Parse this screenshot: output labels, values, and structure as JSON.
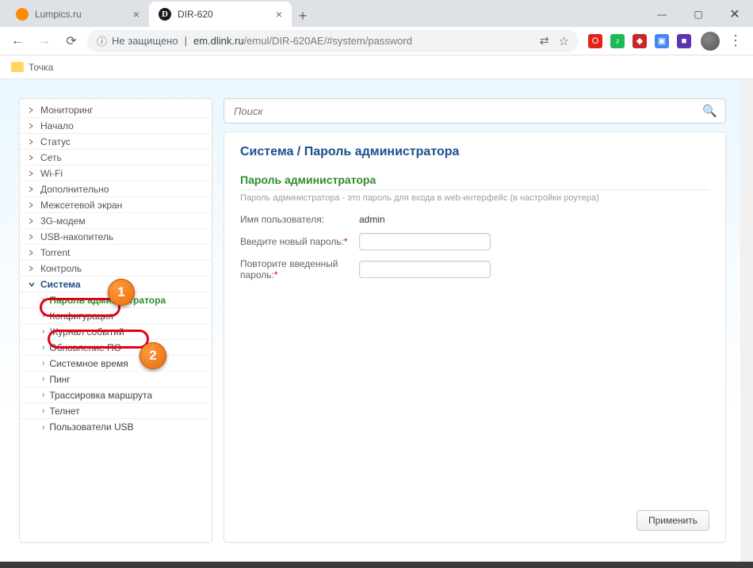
{
  "browser": {
    "tabs": [
      {
        "favicon": "orange",
        "title": "Lumpics.ru",
        "active": false
      },
      {
        "favicon": "dark",
        "title": "DIR-620",
        "active": true
      }
    ],
    "nav": {
      "not_secure": "Не защищено",
      "url_host": "em.dlink.ru",
      "url_path": "/emul/DIR-620AE/#system/password"
    },
    "bookmark": "Точка"
  },
  "sidebar": {
    "items": [
      {
        "label": "Мониторинг"
      },
      {
        "label": "Начало"
      },
      {
        "label": "Статус"
      },
      {
        "label": "Сеть"
      },
      {
        "label": "Wi-Fi"
      },
      {
        "label": "Дополнительно"
      },
      {
        "label": "Межсетевой экран"
      },
      {
        "label": "3G-модем"
      },
      {
        "label": "USB-накопитель"
      },
      {
        "label": "Torrent"
      },
      {
        "label": "Контроль"
      }
    ],
    "expanded": {
      "label": "Система"
    },
    "subitems": [
      {
        "label": "Пароль администратора",
        "active": true
      },
      {
        "label": "Конфигурация"
      },
      {
        "label": "Журнал событий"
      },
      {
        "label": "Обновление ПО"
      },
      {
        "label": "Системное время"
      },
      {
        "label": "Пинг"
      },
      {
        "label": "Трассировка маршрута"
      },
      {
        "label": "Телнет"
      },
      {
        "label": "Пользователи USB"
      }
    ]
  },
  "annotations": {
    "badge1": "1",
    "badge2": "2"
  },
  "search": {
    "placeholder": "Поиск"
  },
  "breadcrumb": {
    "parent": "Система",
    "sep": " /  ",
    "current": "Пароль администратора"
  },
  "section": {
    "title": "Пароль администратора",
    "desc": "Пароль администратора - это пароль для входа в web-интерфейс (в настройки роутера)"
  },
  "form": {
    "username_label": "Имя пользователя:",
    "username_value": "admin",
    "newpass_label": "Введите новый пароль:",
    "repeat_label": "Повторите введенный пароль:",
    "asterisk": "*"
  },
  "apply": "Применить"
}
